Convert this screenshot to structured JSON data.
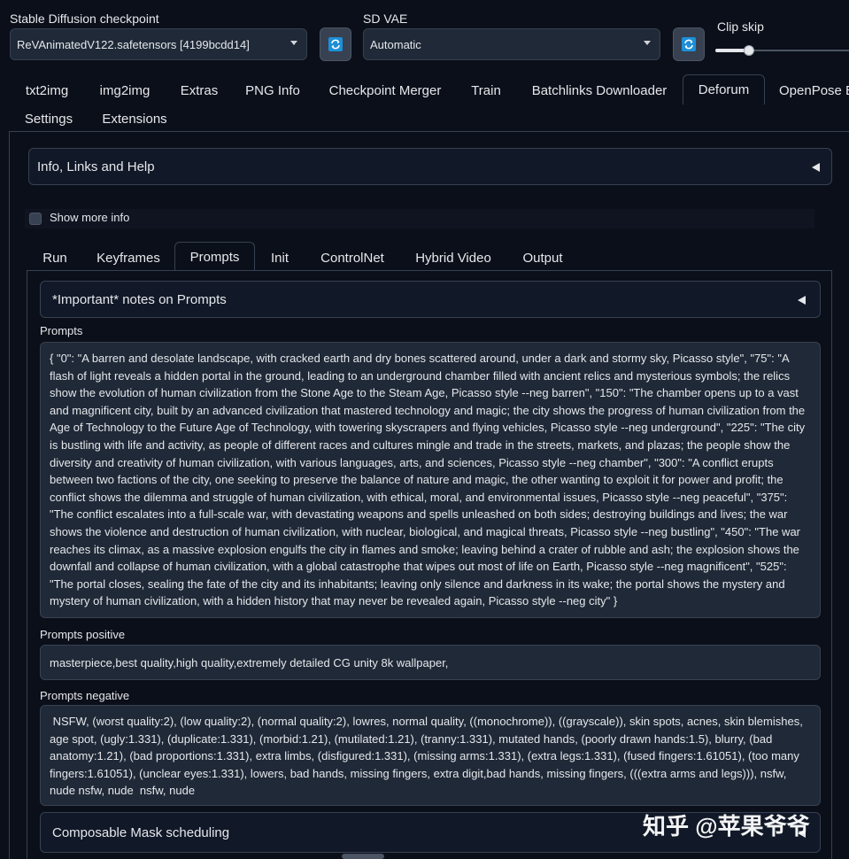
{
  "top": {
    "checkpoint_label": "Stable Diffusion checkpoint",
    "checkpoint_value": "ReVAnimatedV122.safetensors [4199bcdd14]",
    "vae_label": "SD VAE",
    "vae_value": "Automatic",
    "clip_skip_label": "Clip skip",
    "clip_skip_fraction": 0.25
  },
  "main_tabs": [
    {
      "label": "txt2img"
    },
    {
      "label": "img2img"
    },
    {
      "label": "Extras"
    },
    {
      "label": "PNG Info"
    },
    {
      "label": "Checkpoint Merger"
    },
    {
      "label": "Train"
    },
    {
      "label": "Batchlinks Downloader"
    },
    {
      "label": "Deforum"
    },
    {
      "label": "OpenPose E"
    },
    {
      "label": "Settings"
    },
    {
      "label": "Extensions"
    }
  ],
  "active_main_tab": "Deforum",
  "info_accordion": "Info, Links and Help",
  "show_more_info": "Show more info",
  "sub_tabs": [
    {
      "label": "Run"
    },
    {
      "label": "Keyframes"
    },
    {
      "label": "Prompts"
    },
    {
      "label": "Init"
    },
    {
      "label": "ControlNet"
    },
    {
      "label": "Hybrid Video"
    },
    {
      "label": "Output"
    }
  ],
  "active_sub_tab": "Prompts",
  "notes_accordion": "*Important* notes on Prompts",
  "prompts": {
    "label": "Prompts",
    "value": "{ \"0\": \"A barren and desolate landscape, with cracked earth and dry bones scattered around, under a dark and stormy sky, Picasso style\", \"75\": \"A flash of light reveals a hidden portal in the ground, leading to an underground chamber filled with ancient relics and mysterious symbols; the relics show the evolution of human civilization from the Stone Age to the Steam Age, Picasso style --neg barren\", \"150\": \"The chamber opens up to a vast and magnificent city, built by an advanced civilization that mastered technology and magic; the city shows the progress of human civilization from the Age of Technology to the Future Age of Technology, with towering skyscrapers and flying vehicles, Picasso style --neg underground\", \"225\": \"The city is bustling with life and activity, as people of different races and cultures mingle and trade in the streets, markets, and plazas; the people show the diversity and creativity of human civilization, with various languages, arts, and sciences, Picasso style --neg chamber\", \"300\": \"A conflict erupts between two factions of the city, one seeking to preserve the balance of nature and magic, the other wanting to exploit it for power and profit; the conflict shows the dilemma and struggle of human civilization, with ethical, moral, and environmental issues, Picasso style --neg peaceful\", \"375\": \"The conflict escalates into a full-scale war, with devastating weapons and spells unleashed on both sides; destroying buildings and lives; the war shows the violence and destruction of human civilization, with nuclear, biological, and magical threats, Picasso style --neg bustling\", \"450\": \"The war reaches its climax, as a massive explosion engulfs the city in flames and smoke; leaving behind a crater of rubble and ash; the explosion shows the downfall and collapse of human civilization, with a global catastrophe that wipes out most of life on Earth, Picasso style --neg magnificent\", \"525\": \"The portal closes, sealing the fate of the city and its inhabitants; leaving only silence and darkness in its wake; the portal shows the mystery and mystery of human civilization, with a hidden history that may never be revealed again, Picasso style --neg city\" }"
  },
  "prompts_positive": {
    "label": "Prompts positive",
    "value": "masterpiece,best quality,high quality,extremely detailed CG unity 8k wallpaper,"
  },
  "prompts_negative": {
    "label": "Prompts negative",
    "value": " NSFW, (worst quality:2), (low quality:2), (normal quality:2), lowres, normal quality, ((monochrome)), ((grayscale)), skin spots, acnes, skin blemishes, age spot, (ugly:1.331), (duplicate:1.331), (morbid:1.21), (mutilated:1.21), (tranny:1.331), mutated hands, (poorly drawn hands:1.5), blurry, (bad anatomy:1.21), (bad proportions:1.331), extra limbs, (disfigured:1.331), (missing arms:1.331), (extra legs:1.331), (fused fingers:1.61051), (too many fingers:1.61051), (unclear eyes:1.331), lowers, bad hands, missing fingers, extra digit,bad hands, missing fingers, (((extra arms and legs))), nsfw, nude nsfw, nude  nsfw, nude"
  },
  "mask_accordion": "Composable Mask scheduling",
  "watermark": "知乎 @苹果爷爷",
  "colors": {
    "background": "#0b0f19",
    "panel": "#1f2937",
    "border": "#374151",
    "refresh_icon": "#1d8fd8"
  },
  "icons": [
    "refresh-icon",
    "chevron-down-icon",
    "triangle-left-icon"
  ]
}
